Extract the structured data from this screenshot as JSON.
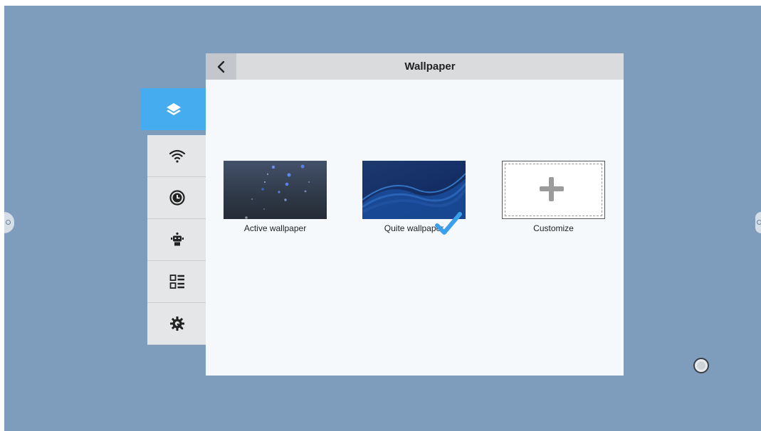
{
  "window": {
    "title": "Wallpaper"
  },
  "header": {
    "back_icon": "chevron-left-icon",
    "title": "Wallpaper"
  },
  "sidebar": {
    "items": [
      {
        "icon": "layers-icon",
        "active": true
      },
      {
        "icon": "wifi-icon",
        "active": false
      },
      {
        "icon": "clock-icon",
        "active": false
      },
      {
        "icon": "robot-icon",
        "active": false
      },
      {
        "icon": "list-grid-icon",
        "active": false
      },
      {
        "icon": "gear-wrench-icon",
        "active": false
      }
    ]
  },
  "wallpapers": [
    {
      "label": "Active wallpaper",
      "selected": false
    },
    {
      "label": "Quite wallpaper",
      "selected": true
    },
    {
      "label": "Customize",
      "selected": false
    }
  ],
  "colors": {
    "background": "#7e9cbc",
    "accent": "#46acf0",
    "panel": "#f5f9fc"
  }
}
